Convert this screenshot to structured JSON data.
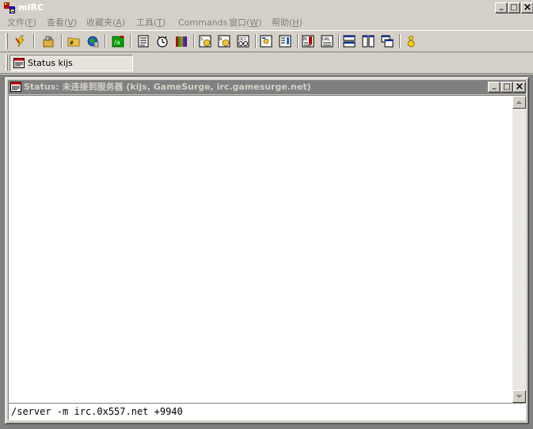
{
  "window": {
    "title": "mIRC",
    "controls": {
      "minimize": "_",
      "maximize": "□",
      "close": "×"
    }
  },
  "menu": [
    {
      "label": "文件(",
      "key": "F",
      "tail": ")"
    },
    {
      "label": "查看(",
      "key": "V",
      "tail": ")"
    },
    {
      "label": "收藏夹(",
      "key": "A",
      "tail": ")"
    },
    {
      "label": "工具(",
      "key": "T",
      "tail": ")"
    },
    {
      "label": "Commands",
      "key": "",
      "tail": ""
    },
    {
      "label": "窗口(",
      "key": "W",
      "tail": ")"
    },
    {
      "label": "帮助(",
      "key": "H",
      "tail": ")"
    }
  ],
  "toolbar": {
    "icons": [
      "connect-icon",
      "options-icon",
      "channels-folder-icon",
      "server-list-icon",
      "remote-icon",
      "address-book-icon",
      "timer-icon",
      "colors-icon",
      "send-file-icon",
      "receive-file-icon",
      "dcc-chat-icon",
      "log-icon",
      "notify-icon",
      "notify-list-icon",
      "url-catcher-icon",
      "tile-horizontal-icon",
      "tile-vertical-icon",
      "cascade-icon",
      "help-icon"
    ]
  },
  "switchbar": {
    "items": [
      {
        "label": "Status kijs"
      }
    ]
  },
  "status_window": {
    "title": "Status: 未连接到服务器 (kijs, GameSurge, irc.gamesurge.net)",
    "output_lines": [],
    "input_value": "/server -m irc.0x557.net +9940"
  },
  "colors": {
    "face": "#d4d0c8",
    "inactive_title": "#808080",
    "mdi_background": "#808080"
  }
}
